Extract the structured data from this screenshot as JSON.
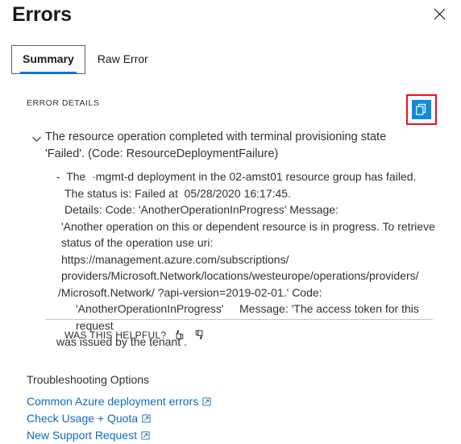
{
  "header": {
    "title": "Errors",
    "close_label": "Close",
    "close_icon": "close-icon"
  },
  "tabs": [
    {
      "label": "Summary",
      "selected": true
    },
    {
      "label": "Raw Error",
      "selected": false
    }
  ],
  "error_details": {
    "section_label": "ERROR DETAILS",
    "copy_button": {
      "icon": "copy-icon",
      "accent_color": "#0f8ae0",
      "highlight_color": "#e81123"
    },
    "expand_icon": "chevron-down-icon",
    "summary": "The resource operation completed with terminal provisioning state 'Failed'. (Code: ResourceDeploymentFailure)",
    "detail_lines": [
      "-  The  ·mgmt-d deployment in the 02-amst01 resource group has failed.",
      "The status is: Failed at  05/28/2020 16:17:45.",
      "Details: Code: 'AnotherOperationInProgress' Message:",
      "'Another operation on this or dependent resource is in progress. To retrieve",
      "status of the operation use uri: https://management.azure.com/subscriptions/",
      "providers/Microsoft.Network/locations/westeurope/operations/providers/",
      "/Microsoft.Network/ ?api-version=2019-02-01.' Code:",
      "'AnotherOperationInProgress'     Message: 'The access token for this request",
      "was issued by the tenant ."
    ]
  },
  "feedback": {
    "label": "WAS THIS HELPFUL?",
    "thumbs_up_icon": "thumbs-up-icon",
    "thumbs_down_icon": "thumbs-down-icon"
  },
  "troubleshooting": {
    "heading": "Troubleshooting Options",
    "link_color": "#0f6cbd",
    "links": [
      {
        "label": "Common Azure deployment errors",
        "icon": "external-link-icon"
      },
      {
        "label": "Check Usage + Quota",
        "icon": "external-link-icon"
      },
      {
        "label": "New Support Request",
        "icon": "external-link-icon"
      }
    ]
  }
}
